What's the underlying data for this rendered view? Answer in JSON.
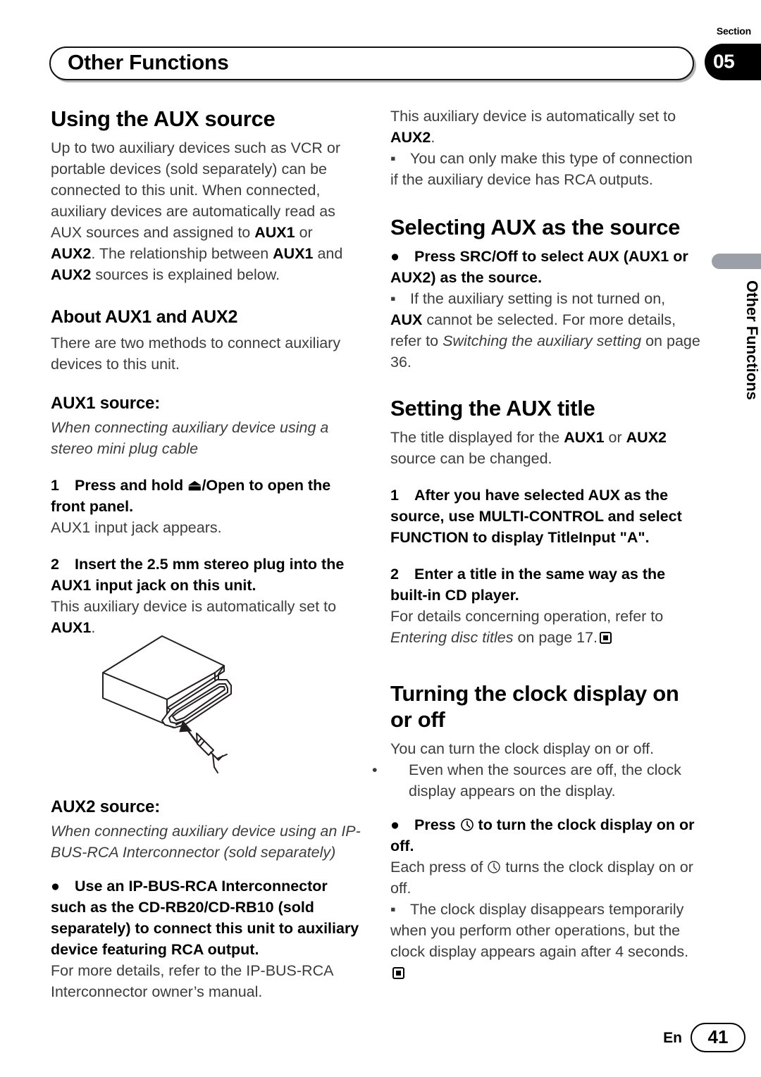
{
  "header": {
    "title": "Other Functions",
    "section_label": "Section",
    "section_number": "05"
  },
  "side_tab": {
    "text": "Other Functions"
  },
  "left_column": {
    "heading_using_aux": "Using the AUX source",
    "intro_p1": "Up to two auxiliary devices such as VCR or portable devices (sold separately) can be connected to this unit. When connected, auxiliary devices are automatically read as AUX sources and assigned to ",
    "intro_aux1": "AUX1",
    "intro_or": " or ",
    "intro_aux2": "AUX2",
    "intro_p2": ". The relationship between ",
    "intro_aux1b": "AUX1",
    "intro_and": " and ",
    "intro_aux2b": "AUX2",
    "intro_p3": " sources is explained below.",
    "heading_about": "About AUX1 and AUX2",
    "about_text": "There are two methods to connect auxiliary devices to this unit.",
    "heading_aux1_source": "AUX1 source:",
    "aux1_italic": "When connecting auxiliary device using a stereo mini plug cable",
    "step1_num": "1",
    "step1_text_a": "Press and hold ",
    "step1_eject": "⏏",
    "step1_text_b": "/Open to open the front panel.",
    "step1_note": "AUX1 input jack appears.",
    "step2_num": "2",
    "step2_text": "Insert the 2.5 mm stereo plug into the AUX1 input jack on this unit.",
    "step2_note_a": "This auxiliary device is automatically set to ",
    "step2_note_bold": "AUX1",
    "step2_note_b": ".",
    "illustration_name": "car-stereo-aux1-jack-illustration",
    "heading_aux2_source": "AUX2 source:",
    "aux2_italic": "When connecting auxiliary device using an IP-BUS-RCA Interconnector (sold separately)",
    "aux2_bullet": "●",
    "aux2_bullet_text": "Use an IP-BUS-RCA Interconnector such as the CD-RB20/CD-RB10 (sold separately) to connect this unit to auxiliary device featuring RCA output.",
    "aux2_note": "For more details, refer to the IP-BUS-RCA Interconnector owner’s manual."
  },
  "right_column": {
    "top_note_a": "This auxiliary device is automatically set to ",
    "top_note_bold": "AUX2",
    "top_note_b": ".",
    "sq_marker": "▪",
    "rca_note": "You can only make this type of connection if the auxiliary device has RCA outputs.",
    "heading_selecting": "Selecting AUX as the source",
    "select_bullet": "●",
    "select_bullet_text": "Press SRC/Off to select AUX (AUX1 or AUX2) as the source.",
    "select_note_a": "If the auxiliary setting is not turned on, ",
    "select_note_bold": "AUX",
    "select_note_b": " cannot be selected. For more details, refer to ",
    "select_note_italic": "Switching the auxiliary setting",
    "select_note_c": " on page 36.",
    "heading_setting_title": "Setting the AUX title",
    "setting_intro_a": "The title displayed for the ",
    "setting_intro_aux1": "AUX1",
    "setting_intro_or": " or ",
    "setting_intro_aux2": "AUX2",
    "setting_intro_b": " source can be changed.",
    "step1_num": "1",
    "step1_text": "After you have selected AUX as the source, use MULTI-CONTROL and select FUNCTION to display TitleInput \"A\".",
    "step2_num": "2",
    "step2_text": "Enter a title in the same way as the built-in CD player.",
    "step2_note_a": "For details concerning operation, refer to ",
    "step2_note_italic": "Entering disc titles",
    "step2_note_b": " on page 17.",
    "heading_clock": "Turning the clock display on or off",
    "clock_intro": "You can turn the clock display on or off.",
    "clock_dot": "•",
    "clock_sub_note": "Even when the sources are off, the clock display appears on the display.",
    "clock_bullet": "●",
    "clock_bullet_a": "Press ",
    "clock_bullet_b": " to turn the clock display on or off.",
    "clock_each_a": "Each press of ",
    "clock_each_b": " turns the clock display on or off.",
    "clock_note": "The clock display disappears temporarily when you perform other operations, but the clock display appears again after 4 seconds."
  },
  "footer": {
    "language": "En",
    "page_number": "41"
  }
}
